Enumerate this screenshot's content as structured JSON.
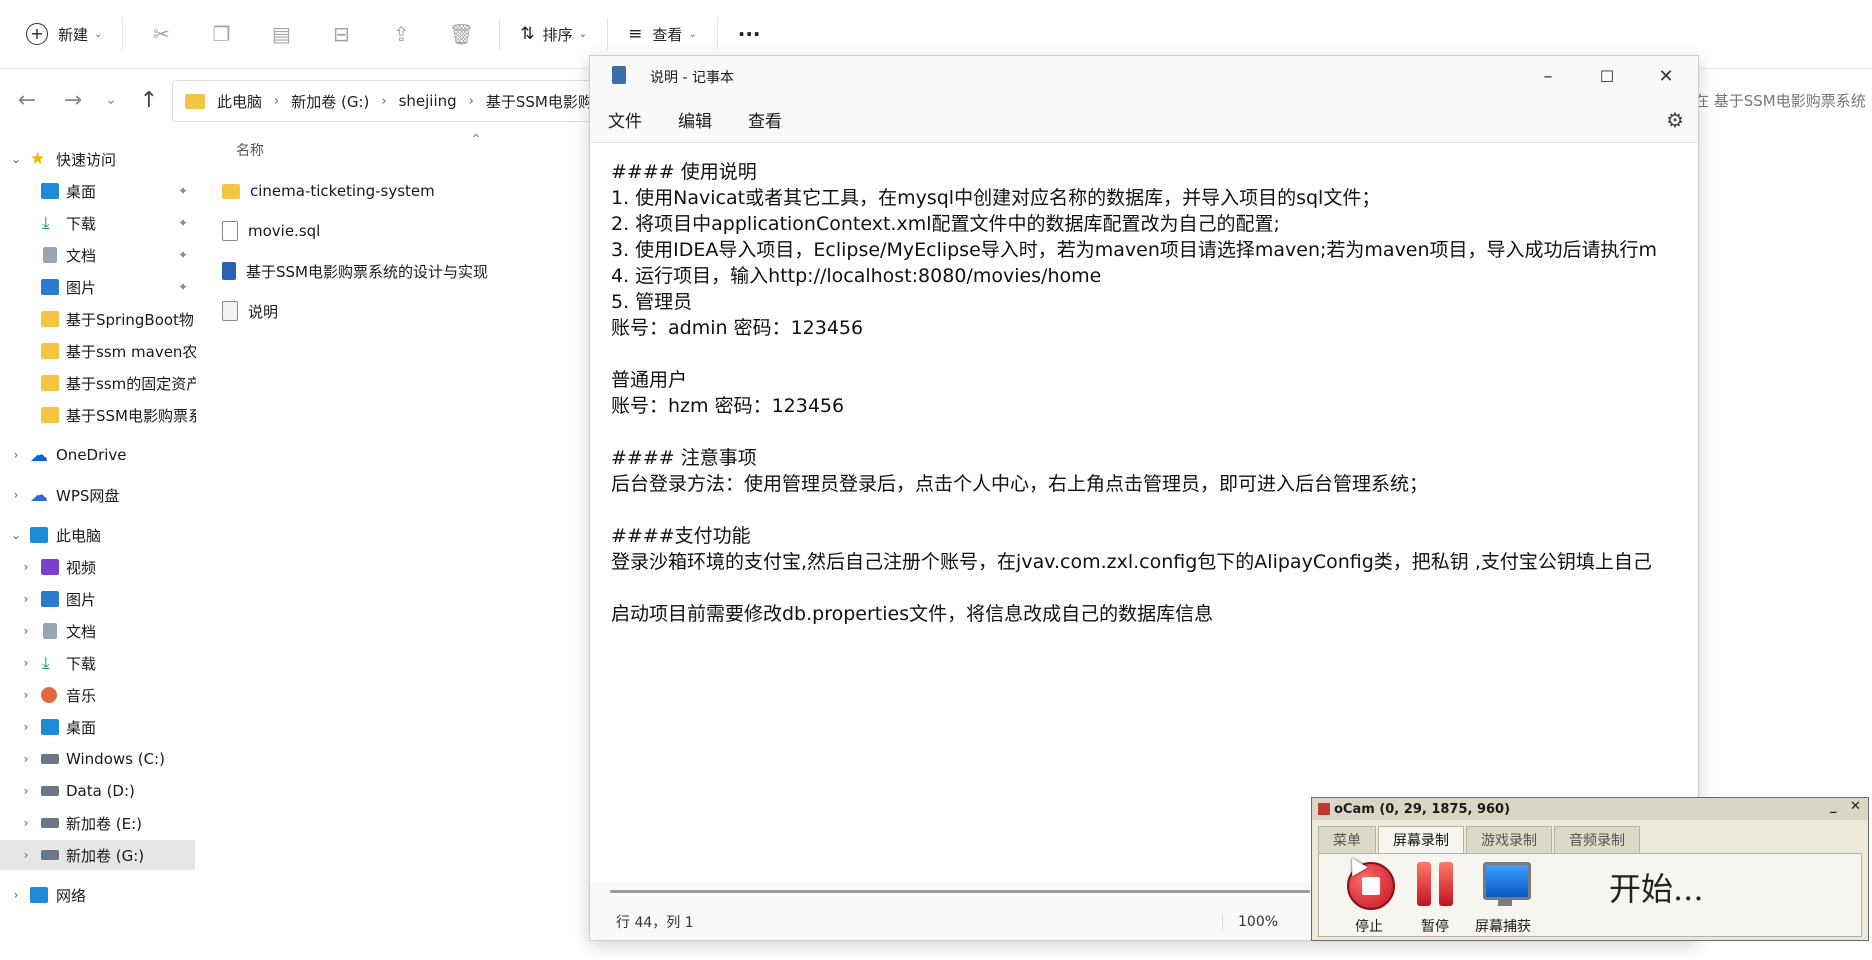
{
  "explorer": {
    "toolbar": {
      "new_label": "新建",
      "sort_label": "排序",
      "view_label": "查看",
      "more_label": "···"
    },
    "breadcrumb": [
      "此电脑",
      "新加卷 (G:)",
      "shejiing",
      "基于SSM电影购"
    ],
    "search_placeholder": "在 基于SSM电影购票系统",
    "sidebar": {
      "quick_access": "快速访问",
      "pinned": [
        "桌面",
        "下载",
        "文档",
        "图片"
      ],
      "recent": [
        "基于SpringBoot物",
        "基于ssm maven农",
        "基于ssm的固定资产",
        "基于SSM电影购票系"
      ],
      "onedrive": "OneDrive",
      "wps": "WPS网盘",
      "this_pc": "此电脑",
      "pc_items": [
        "视频",
        "图片",
        "文档",
        "下载",
        "音乐",
        "桌面",
        "Windows (C:)",
        "Data (D:)",
        "新加卷 (E:)",
        "新加卷 (G:)"
      ],
      "network": "网络"
    },
    "file_list": {
      "column_name": "名称",
      "files": [
        "cinema-ticketing-system",
        "movie.sql",
        "基于SSM电影购票系统的设计与实现",
        "说明"
      ]
    }
  },
  "notepad": {
    "title": "说明 - 记事本",
    "menu": [
      "文件",
      "编辑",
      "查看"
    ],
    "lines": [
      "#### 使用说明",
      "1. 使用Navicat或者其它工具，在mysql中创建对应名称的数据库，并导入项目的sql文件；",
      "2. 将项目中applicationContext.xml配置文件中的数据库配置改为自己的配置;",
      "3. 使用IDEA导入项目，Eclipse/MyEclipse导入时，若为maven项目请选择maven;若为maven项目，导入成功后请执行m",
      "4. 运行项目，输入http://localhost:8080/movies/home",
      "5. 管理员",
      "账号：admin 密码：123456",
      "",
      "普通用户",
      "账号：hzm 密码：123456",
      "",
      "#### 注意事项",
      "后台登录方法：使用管理员登录后，点击个人中心，右上角点击管理员，即可进入后台管理系统；",
      "",
      "####支付功能",
      "登录沙箱环境的支付宝,然后自己注册个账号，在jvav.com.zxl.config包下的AlipayConfig类，把私钥 ,支付宝公钥填上自己",
      "",
      "启动项目前需要修改db.properties文件，将信息改成自己的数据库信息"
    ],
    "status": {
      "position": "行 44，列 1",
      "zoom": "100%"
    }
  },
  "ocam": {
    "title": "oCam (0, 29, 1875, 960)",
    "tabs": [
      "菜单",
      "屏幕录制",
      "游戏录制",
      "音频录制"
    ],
    "buttons": {
      "stop": "停止",
      "pause": "暂停",
      "capture": "屏幕捕获"
    },
    "start_text": "开始..."
  }
}
